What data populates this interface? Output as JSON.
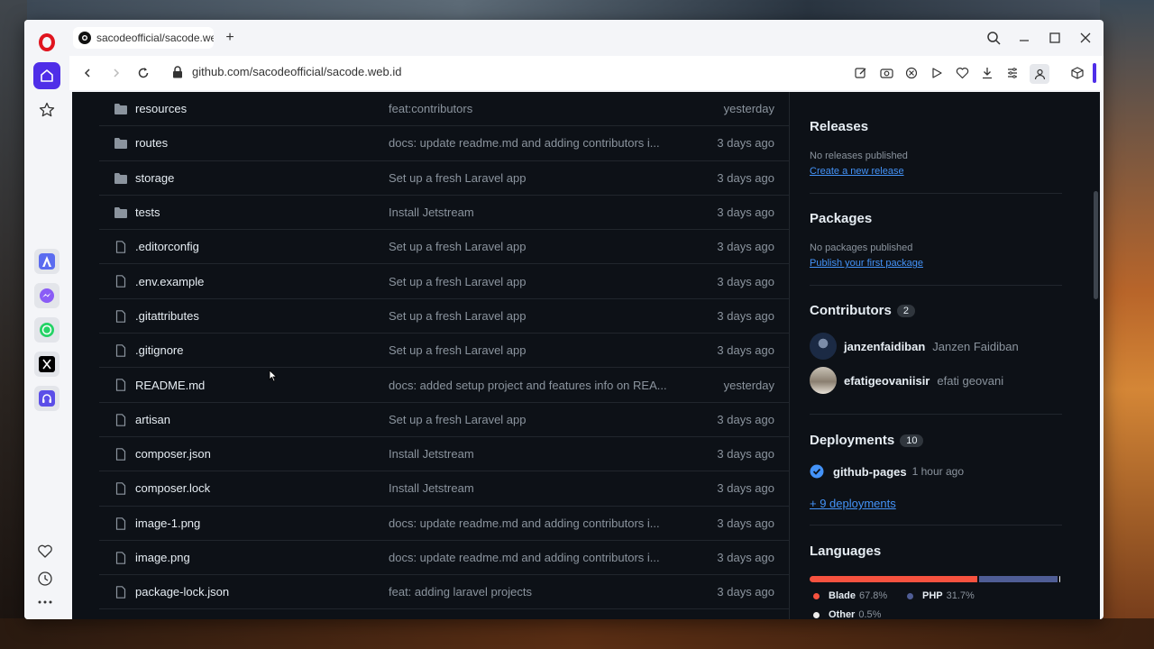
{
  "browser": {
    "tab_title": "sacodeofficial/sacode.web",
    "url": "github.com/sacodeofficial/sacode.web.id"
  },
  "files": [
    {
      "type": "folder",
      "name": "resources",
      "message": "feat:contributors",
      "date": "yesterday"
    },
    {
      "type": "folder",
      "name": "routes",
      "message": "docs: update readme.md and adding contributors i...",
      "date": "3 days ago"
    },
    {
      "type": "folder",
      "name": "storage",
      "message": "Set up a fresh Laravel app",
      "date": "3 days ago"
    },
    {
      "type": "folder",
      "name": "tests",
      "message": "Install Jetstream",
      "date": "3 days ago"
    },
    {
      "type": "file",
      "name": ".editorconfig",
      "message": "Set up a fresh Laravel app",
      "date": "3 days ago"
    },
    {
      "type": "file",
      "name": ".env.example",
      "message": "Set up a fresh Laravel app",
      "date": "3 days ago"
    },
    {
      "type": "file",
      "name": ".gitattributes",
      "message": "Set up a fresh Laravel app",
      "date": "3 days ago"
    },
    {
      "type": "file",
      "name": ".gitignore",
      "message": "Set up a fresh Laravel app",
      "date": "3 days ago"
    },
    {
      "type": "file",
      "name": "README.md",
      "message": "docs: added setup project and features info on REA...",
      "date": "yesterday"
    },
    {
      "type": "file",
      "name": "artisan",
      "message": "Set up a fresh Laravel app",
      "date": "3 days ago"
    },
    {
      "type": "file",
      "name": "composer.json",
      "message": "Install Jetstream",
      "date": "3 days ago"
    },
    {
      "type": "file",
      "name": "composer.lock",
      "message": "Install Jetstream",
      "date": "3 days ago"
    },
    {
      "type": "file",
      "name": "image-1.png",
      "message": "docs: update readme.md and adding contributors i...",
      "date": "3 days ago"
    },
    {
      "type": "file",
      "name": "image.png",
      "message": "docs: update readme.md and adding contributors i...",
      "date": "3 days ago"
    },
    {
      "type": "file",
      "name": "package-lock.json",
      "message": "feat: adding laravel projects",
      "date": "3 days ago"
    }
  ],
  "sidebar": {
    "releases": {
      "title": "Releases",
      "status": "No releases published",
      "link": "Create a new release"
    },
    "packages": {
      "title": "Packages",
      "status": "No packages published",
      "link": "Publish your first package"
    },
    "contributors": {
      "title": "Contributors",
      "count": "2",
      "items": [
        {
          "login": "janzenfaidiban",
          "name": "Janzen Faidiban"
        },
        {
          "login": "efatigeovaniisir",
          "name": "efati geovani"
        }
      ]
    },
    "deployments": {
      "title": "Deployments",
      "count": "10",
      "env": "github-pages",
      "time": "1 hour ago",
      "more": "+ 9 deployments"
    },
    "languages": {
      "title": "Languages",
      "items": [
        {
          "name": "Blade",
          "percent": "67.8%",
          "value": 67.8,
          "color": "#f7523f"
        },
        {
          "name": "PHP",
          "percent": "31.7%",
          "value": 31.7,
          "color": "#4f5d95"
        },
        {
          "name": "Other",
          "percent": "0.5%",
          "value": 0.5,
          "color": "#ededed"
        }
      ]
    }
  }
}
